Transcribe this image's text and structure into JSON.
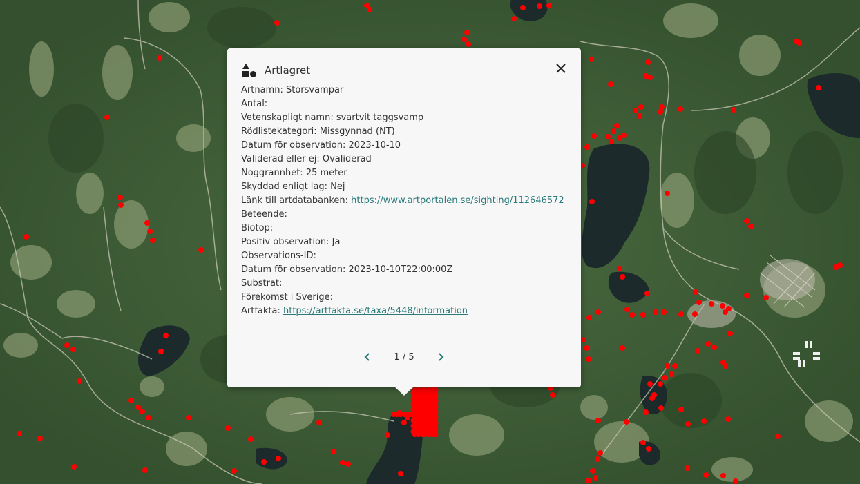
{
  "map": {
    "marker_color": "#ff0000"
  },
  "popup": {
    "layer_icon": "shapes-icon",
    "title": "Artlagret",
    "close_icon": "close-icon",
    "attributes": [
      {
        "label": "Artnamn:",
        "value": "Storsvampar"
      },
      {
        "label": "Antal:",
        "value": ""
      },
      {
        "label": "Vetenskapligt namn:",
        "value": "svartvit taggsvamp"
      },
      {
        "label": "Rödlistekategori:",
        "value": "Missgynnad (NT)"
      },
      {
        "label": "Datum för observation:",
        "value": "2023-10-10"
      },
      {
        "label": "Validerad eller ej:",
        "value": "Ovaliderad"
      },
      {
        "label": "Noggrannhet:",
        "value": "25 meter"
      },
      {
        "label": "Skyddad enligt lag:",
        "value": "Nej"
      },
      {
        "label": "Länk till artdatabanken:",
        "value": "https://www.artportalen.se/sighting/112646572",
        "link": true
      },
      {
        "label": "Beteende:",
        "value": ""
      },
      {
        "label": "Biotop:",
        "value": ""
      },
      {
        "label": "Positiv observation:",
        "value": "Ja"
      },
      {
        "label": "Observations-ID:",
        "value": ""
      },
      {
        "label": "Datum för observation:",
        "value": "2023-10-10T22:00:00Z"
      },
      {
        "label": "Substrat:",
        "value": ""
      },
      {
        "label": "Förekomst i Sverige:",
        "value": ""
      },
      {
        "label": "Artfakta:",
        "value": "https://artfakta.se/taxa/5448/information",
        "link": true
      }
    ],
    "pager": {
      "prev_icon": "chevron-left-icon",
      "next_icon": "chevron-right-icon",
      "text": "1 / 5"
    },
    "link_color": "#2a7a7a"
  }
}
